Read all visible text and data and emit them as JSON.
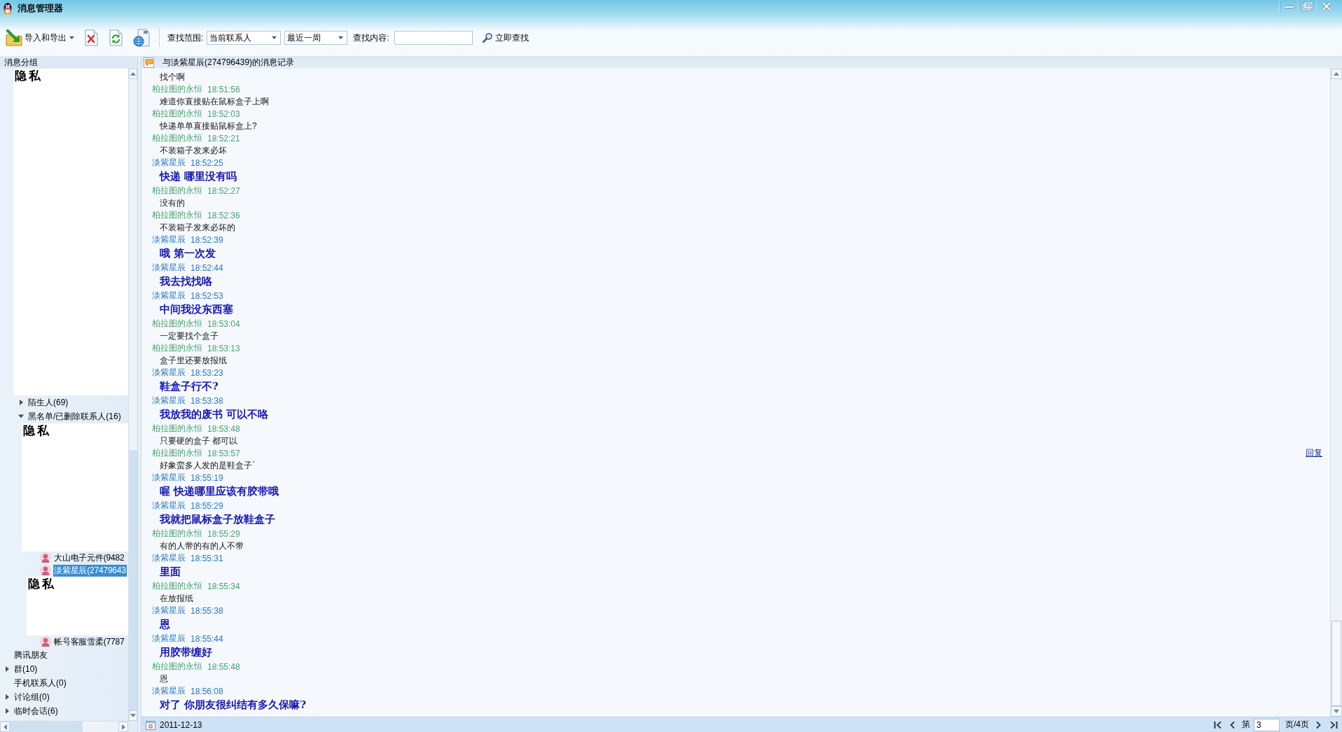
{
  "window": {
    "title": "消息管理器"
  },
  "toolbar": {
    "import_export": {
      "label": "导入和导出"
    },
    "scope_label": "查找范围:",
    "scope_select": {
      "value": "当前联系人"
    },
    "period_select": {
      "value": "最近一周"
    },
    "content_label": "查找内容:",
    "search_button": {
      "label": "立即查找"
    }
  },
  "sidebar": {
    "title": "消息分组",
    "tree": [
      {
        "kind": "mask",
        "label": "隐私",
        "children": [
          {
            "kind": "group",
            "label": "陌生人(69)",
            "expanded": false
          },
          {
            "kind": "group",
            "label": "黑名单/已删除联系人(16)",
            "expanded": true,
            "children": [
              {
                "kind": "mask",
                "label": "隐私"
              },
              {
                "kind": "contact",
                "label": "大山电子元件(9482",
                "selected": false
              },
              {
                "kind": "contact",
                "label": "淡紫星辰(27479643",
                "selected": true
              },
              {
                "kind": "mask",
                "label": "隐私"
              },
              {
                "kind": "contact",
                "label": "帐号客服雪柔(7787",
                "selected": false
              }
            ]
          }
        ]
      },
      {
        "kind": "leaf",
        "label": "腾讯朋友"
      },
      {
        "kind": "group",
        "label": "群(10)",
        "expanded": false
      },
      {
        "kind": "leaf",
        "label": "手机联系人(0)"
      },
      {
        "kind": "group",
        "label": "讨论组(0)",
        "expanded": false
      },
      {
        "kind": "group",
        "label": "临时会话(6)",
        "expanded": false
      }
    ]
  },
  "conversation": {
    "title": "与淡紫星辰(274796439)的消息记录",
    "messages": [
      {
        "kind": "sent",
        "text": "找个啊"
      },
      {
        "kind": "sent",
        "sender": "柏拉图的永恒",
        "time": "18:51:56",
        "text": "难道你直接贴在鼠标盒子上啊"
      },
      {
        "kind": "sent",
        "sender": "柏拉图的永恒",
        "time": "18:52:03",
        "text": "快递单单直接贴鼠标盒上?"
      },
      {
        "kind": "sent",
        "sender": "柏拉图的永恒",
        "time": "18:52:21",
        "text": "不装箱子发来必坏"
      },
      {
        "kind": "received",
        "sender": "淡紫星辰",
        "time": "18:52:25",
        "text": "快递 哪里没有吗"
      },
      {
        "kind": "sent",
        "sender": "柏拉图的永恒",
        "time": "18:52:27",
        "text": "没有的"
      },
      {
        "kind": "sent",
        "sender": "柏拉图的永恒",
        "time": "18:52:36",
        "text": "不装箱子发来必坏的"
      },
      {
        "kind": "received",
        "sender": "淡紫星辰",
        "time": "18:52:39",
        "text": "哦 第一次发"
      },
      {
        "kind": "received",
        "sender": "淡紫星辰",
        "time": "18:52:44",
        "text": "我去找找咯"
      },
      {
        "kind": "received",
        "sender": "淡紫星辰",
        "time": "18:52:53",
        "text": "中间我没东西塞"
      },
      {
        "kind": "sent",
        "sender": "柏拉图的永恒",
        "time": "18:53:04",
        "text": "一定要找个盒子"
      },
      {
        "kind": "sent",
        "sender": "柏拉图的永恒",
        "time": "18:53:13",
        "text": "盒子里还要放报纸"
      },
      {
        "kind": "received",
        "sender": "淡紫星辰",
        "time": "18:53:23",
        "text": "鞋盒子行不?"
      },
      {
        "kind": "received",
        "sender": "淡紫星辰",
        "time": "18:53:38",
        "text": "我放我的废书 可以不咯"
      },
      {
        "kind": "sent",
        "sender": "柏拉图的永恒",
        "time": "18:53:48",
        "text": "只要硬的盒子 都可以"
      },
      {
        "kind": "sent",
        "sender": "柏拉图的永恒",
        "time": "18:53:57",
        "text": "好象蛮多人发的是鞋盒子`",
        "action": "回复"
      },
      {
        "kind": "received",
        "sender": "淡紫星辰",
        "time": "18:55:19",
        "text": "喔 快递哪里应该有胶带哦"
      },
      {
        "kind": "received",
        "sender": "淡紫星辰",
        "time": "18:55:29",
        "text": "我就把鼠标盒子放鞋盒子"
      },
      {
        "kind": "sent",
        "sender": "柏拉图的永恒",
        "time": "18:55:29",
        "text": "有的人带的有的人不带"
      },
      {
        "kind": "received",
        "sender": "淡紫星辰",
        "time": "18:55:31",
        "text": "里面"
      },
      {
        "kind": "sent",
        "sender": "柏拉图的永恒",
        "time": "18:55:34",
        "text": "在放报纸"
      },
      {
        "kind": "received",
        "sender": "淡紫星辰",
        "time": "18:55:38",
        "text": "恩"
      },
      {
        "kind": "received",
        "sender": "淡紫星辰",
        "time": "18:55:44",
        "text": "用胶带缠好"
      },
      {
        "kind": "sent",
        "sender": "柏拉图的永恒",
        "time": "18:55:48",
        "text": "恩"
      },
      {
        "kind": "received",
        "sender": "淡紫星辰",
        "time": "18:56:08",
        "text": "对了 你朋友很纠结有多久保嘛?"
      }
    ]
  },
  "status_bar": {
    "date": "2011-12-13",
    "page_prefix": "第",
    "page_value": "3",
    "page_suffix": "页/4页"
  }
}
